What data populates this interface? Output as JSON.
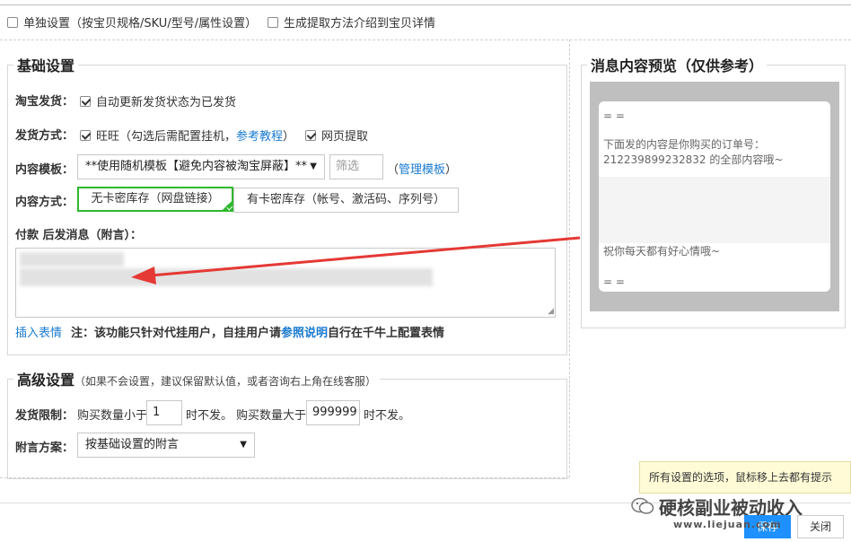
{
  "top_options": {
    "separate_setting": "单独设置（按宝贝规格/SKU/型号/属性设置）",
    "generate_method": "生成提取方法介绍到宝贝详情"
  },
  "basic": {
    "legend": "基础设置",
    "taobao": {
      "label": "淘宝发货：",
      "auto_update": "自动更新发货状态为已发货"
    },
    "delivery": {
      "label": "发货方式：",
      "wangwang": "旺旺（勾选后需配置挂机，",
      "tutorial_link": "参考教程",
      "wangwang_close": "）",
      "web": "网页提取"
    },
    "template": {
      "label": "内容模板：",
      "selected": "**使用随机模板【避免内容被淘宝屏蔽】**",
      "filter_placeholder": "筛选",
      "manage_open": "（",
      "manage_link": "管理模板",
      "manage_close": "）"
    },
    "content_type": {
      "label": "内容方式：",
      "option_no_card": "无卡密库存（网盘链接）",
      "option_card": "有卡密库存（帐号、激活码、序列号）"
    },
    "post_payment_label": "付款 后发消息（附言）：",
    "insert_emoji": "插入表情",
    "note_prefix": "注：该功能只针对代挂用户，自挂用户请",
    "note_link": "参照说明",
    "note_suffix": "自行在千牛上配置表情"
  },
  "advanced": {
    "legend": "高级设置",
    "legend_sub": "（如果不会设置，建议保留默认值，或者咨询右上角在线客服）",
    "limit_label": "发货限制：",
    "buy_less_than": "购买数量小于",
    "min_value": "1",
    "no_ship_1": "时不发。",
    "buy_more_than": "购买数量大于",
    "max_value": "999999",
    "no_ship_2": "时不发。",
    "note_scheme_label": "附言方案：",
    "note_scheme_selected": "按基础设置的附言"
  },
  "preview": {
    "legend": "消息内容预览（仅供参考）",
    "line_sep_top": "= =",
    "line_1": "下面发的内容是你购买的订单号：",
    "line_2": "212239899232832 的全部内容哦~",
    "line_3": "祝你每天都有好心情哦~",
    "line_sep_bottom": "= ="
  },
  "tooltip": "所有设置的选项，鼠标移上去都有提示",
  "footer": {
    "save": "保存",
    "close": "关闭",
    "watermark_title": "硬核副业被动收入",
    "watermark_url": "www.liejuan.com"
  },
  "colors": {
    "accent": "#2eb82e",
    "link": "#1a7bd1",
    "primary_button": "#1e90ff",
    "arrow": "#e53935"
  },
  "checkbox_states": {
    "separate_setting": false,
    "generate_method": false,
    "auto_update": true,
    "wangwang": true,
    "web": true
  }
}
